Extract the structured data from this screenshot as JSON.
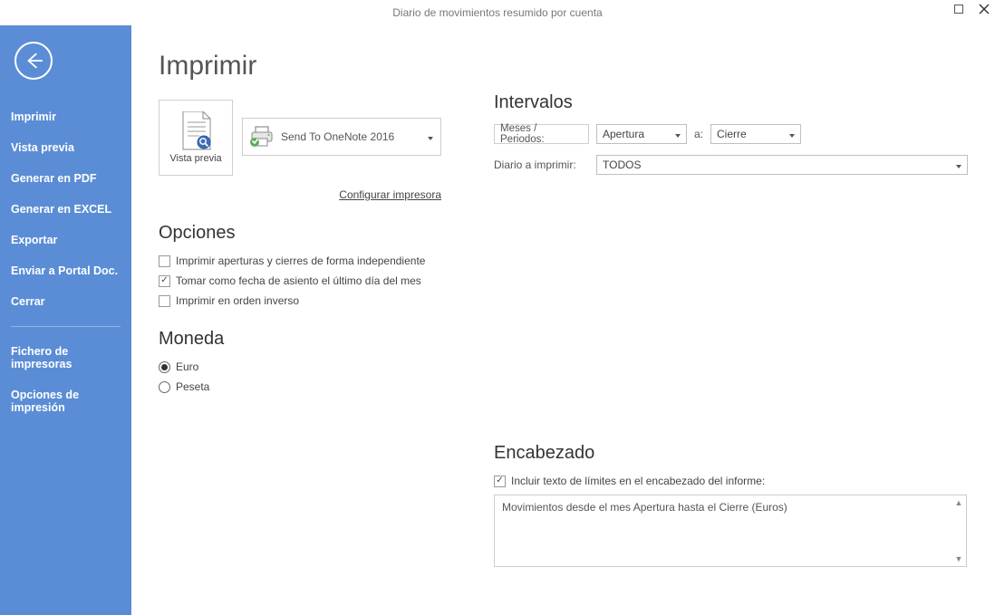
{
  "window": {
    "title": "Diario de movimientos resumido por cuenta"
  },
  "sidebar": {
    "items": [
      {
        "label": "Imprimir"
      },
      {
        "label": "Vista previa"
      },
      {
        "label": "Generar en PDF"
      },
      {
        "label": "Generar en EXCEL"
      },
      {
        "label": "Exportar"
      },
      {
        "label": "Enviar a Portal Doc."
      },
      {
        "label": "Cerrar"
      }
    ],
    "items2": [
      {
        "label": "Fichero de impresoras"
      },
      {
        "label": "Opciones de impresión"
      }
    ]
  },
  "page": {
    "title": "Imprimir",
    "preview_label": "Vista previa",
    "printer_selected": "Send To OneNote 2016",
    "config_link": "Configurar impresora"
  },
  "options": {
    "heading": "Opciones",
    "opt1": "Imprimir aperturas y cierres de forma independiente",
    "opt2": "Tomar como fecha de asiento el último día del mes",
    "opt3": "Imprimir en orden inverso"
  },
  "currency": {
    "heading": "Moneda",
    "opt_euro": "Euro",
    "opt_peseta": "Peseta"
  },
  "intervals": {
    "heading": "Intervalos",
    "months_label": "Meses / Periodos:",
    "from_value": "Apertura",
    "to_label": "a:",
    "to_value": "Cierre",
    "diary_label": "Diario a imprimir:",
    "diary_value": "TODOS"
  },
  "header": {
    "heading": "Encabezado",
    "include_label": "Incluir texto de límites en el encabezado del informe:",
    "text": "Movimientos desde el mes Apertura hasta el Cierre (Euros)"
  }
}
